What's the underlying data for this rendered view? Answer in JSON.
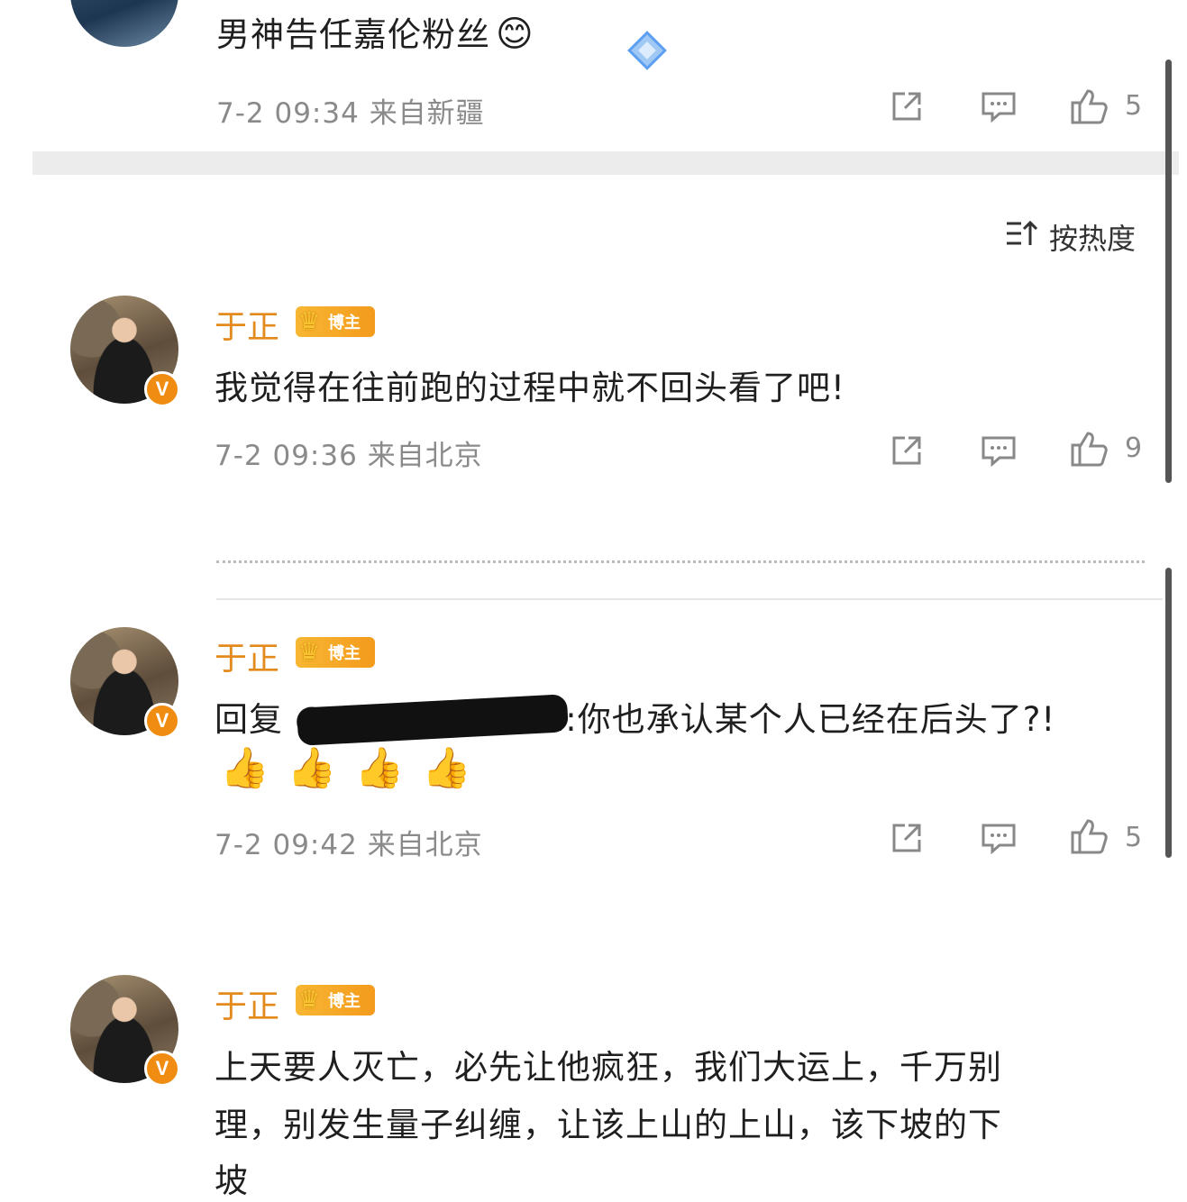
{
  "top_comment": {
    "text": "男神告任嘉伦粉丝",
    "emoji": "😊",
    "time": "7-2 09:34",
    "location": "来自新疆",
    "likes": "5"
  },
  "sort": {
    "label": "按热度",
    "icon": "sort-icon"
  },
  "comments": [
    {
      "user": "于正",
      "badge": "博主",
      "verified": "V",
      "text": "我觉得在往前跑的过程中就不回头看了吧!",
      "time": "7-2 09:36",
      "location": "来自北京",
      "likes": "9"
    },
    {
      "user": "于正",
      "badge": "博主",
      "verified": "V",
      "reply_prefix": "回复 @",
      "reply_suffix": "1:你也承认某个人已经在后头了?!",
      "emoji": "👍",
      "time": "7-2 09:42",
      "location": "来自北京",
      "likes": "5"
    },
    {
      "user": "于正",
      "badge": "博主",
      "verified": "V",
      "line1": "上天要人灭亡，必先让他疯狂，我们大运上，千万别",
      "line2": "理，别发生量子纠缠，让该上山的上山，该下坡的下",
      "line3": "坡"
    }
  ],
  "colors": {
    "username": "#e38a1c",
    "badge": "#f49a1c",
    "meta": "#8a8a8a"
  }
}
